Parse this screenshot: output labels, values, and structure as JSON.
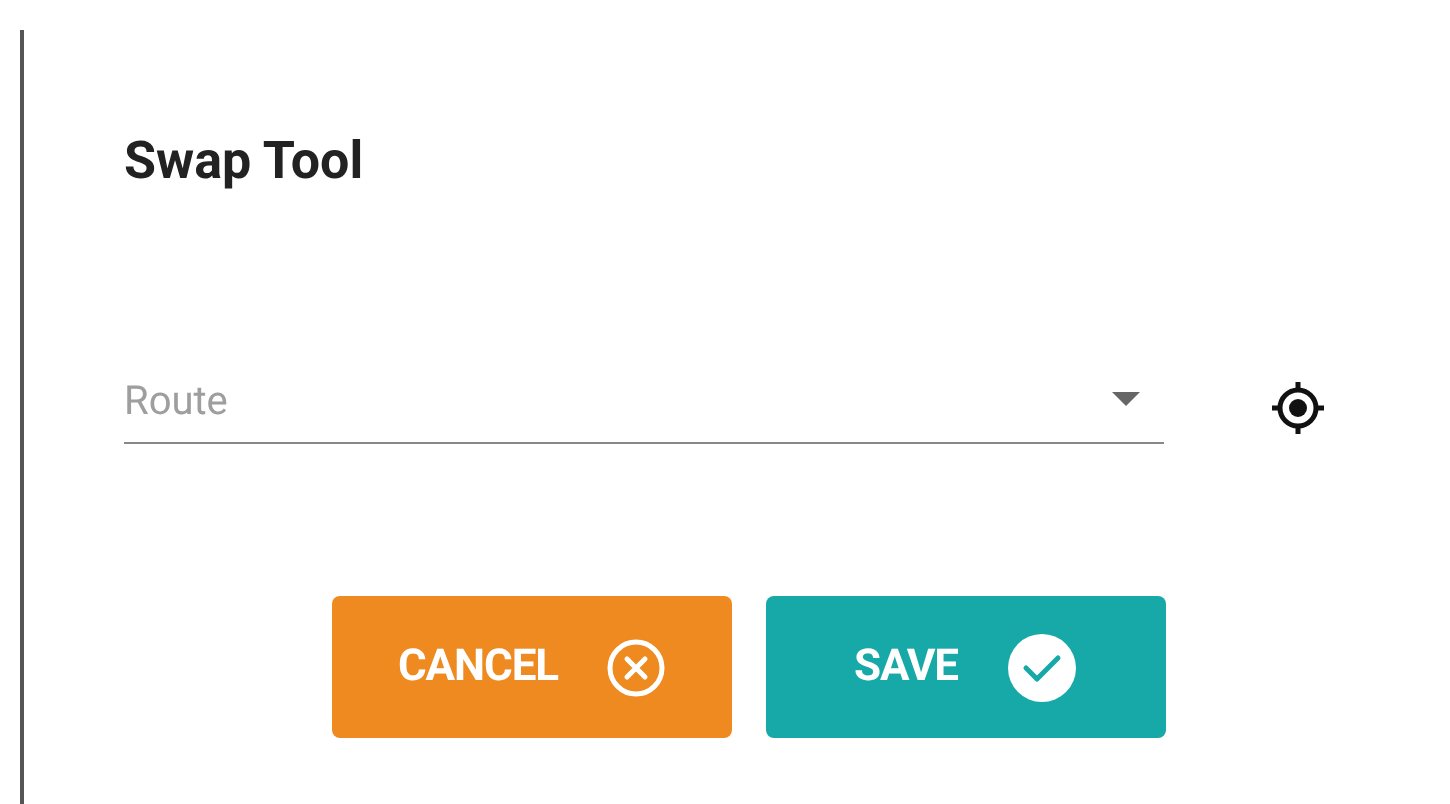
{
  "dialog": {
    "title": "Swap Tool",
    "route_field": {
      "placeholder": "Route"
    },
    "buttons": [
      {
        "label": "CANCEL",
        "kind": "cancel"
      },
      {
        "label": "SAVE",
        "kind": "save"
      }
    ]
  }
}
